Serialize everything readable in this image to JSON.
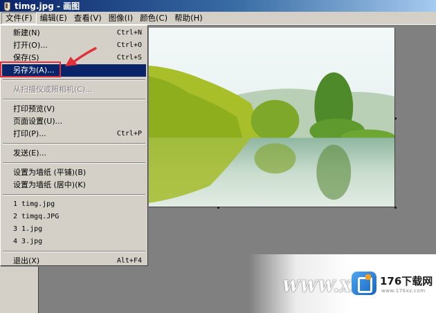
{
  "window": {
    "title": "timg.jpg - 画图"
  },
  "menubar": {
    "items": [
      "文件(F)",
      "编辑(E)",
      "查看(V)",
      "图像(I)",
      "颜色(C)",
      "帮助(H)"
    ]
  },
  "file_menu": {
    "new": {
      "label": "新建(N)",
      "shortcut": "Ctrl+N"
    },
    "open": {
      "label": "打开(O)...",
      "shortcut": "Ctrl+O"
    },
    "save": {
      "label": "保存(S)",
      "shortcut": "Ctrl+S"
    },
    "save_as": {
      "label": "另存为(A)..."
    },
    "from_scanner": {
      "label": "从扫描仪或照相机(C)..."
    },
    "print_preview": {
      "label": "打印预览(V)"
    },
    "page_setup": {
      "label": "页面设置(U)..."
    },
    "print": {
      "label": "打印(P)...",
      "shortcut": "Ctrl+P"
    },
    "send": {
      "label": "发送(E)..."
    },
    "wallpaper_tile": {
      "label": "设置为墙纸 (平铺)(B)"
    },
    "wallpaper_center": {
      "label": "设置为墙纸 (居中)(K)"
    },
    "recent_files": [
      "1 timg.jpg",
      "2 timgq.JPG",
      "3 1.jpg",
      "4 3.jpg"
    ],
    "exit": {
      "label": "退出(X)",
      "shortcut": "Alt+F4"
    }
  },
  "watermark": {
    "text": "WWW.XF",
    "brand": "176下载网",
    "site": "www.176xz.com"
  },
  "colors": {
    "highlight": "#0a246a",
    "annotation_red": "#e0303a",
    "workspace": "#808080"
  },
  "icons": {
    "app": "paint-brush-icon",
    "annotation": "red-arrow-icon"
  }
}
